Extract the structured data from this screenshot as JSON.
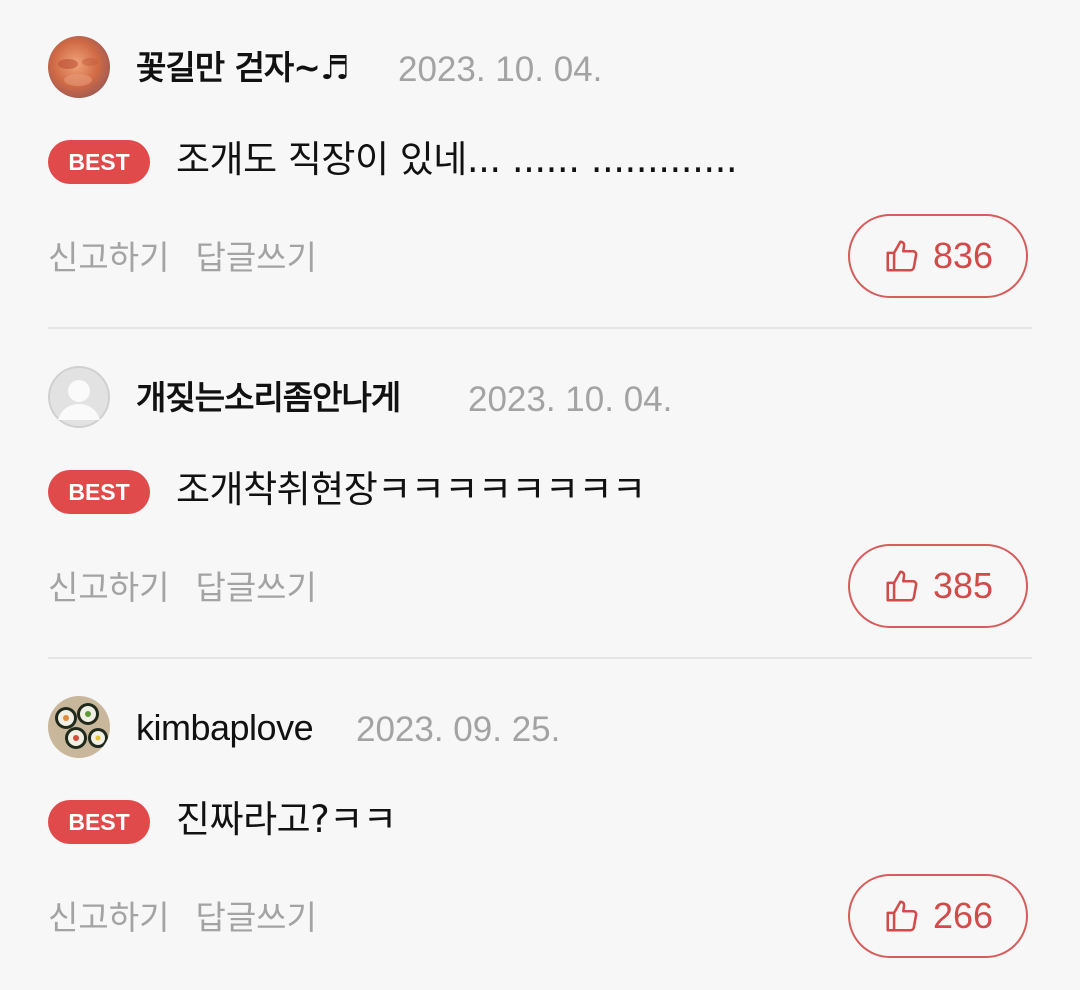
{
  "comments": [
    {
      "username": "꽃길만 걷자~♬",
      "date": "2023. 10. 04.",
      "badge": "BEST",
      "text": "조개도 직장이 있네... ...... .............",
      "report_label": "신고하기",
      "reply_label": "답글쓰기",
      "likes": "836",
      "avatar_icon": "profile-photo-face"
    },
    {
      "username": "개짖는소리좀안나게",
      "date": "2023. 10. 04.",
      "badge": "BEST",
      "text": "조개착취현장ㅋㅋㅋㅋㅋㅋㅋㅋ",
      "report_label": "신고하기",
      "reply_label": "답글쓰기",
      "likes": "385",
      "avatar_icon": "default-user-icon"
    },
    {
      "username": "kimbaplove",
      "date": "2023. 09. 25.",
      "badge": "BEST",
      "text": "진짜라고?ㅋㅋ",
      "report_label": "신고하기",
      "reply_label": "답글쓰기",
      "likes": "266",
      "avatar_icon": "kimbap-photo"
    }
  ],
  "colors": {
    "background": "#f7f7f7",
    "best_badge": "#e04a4a",
    "like_accent": "#d14b4b",
    "muted_text": "#a3a3a3"
  }
}
